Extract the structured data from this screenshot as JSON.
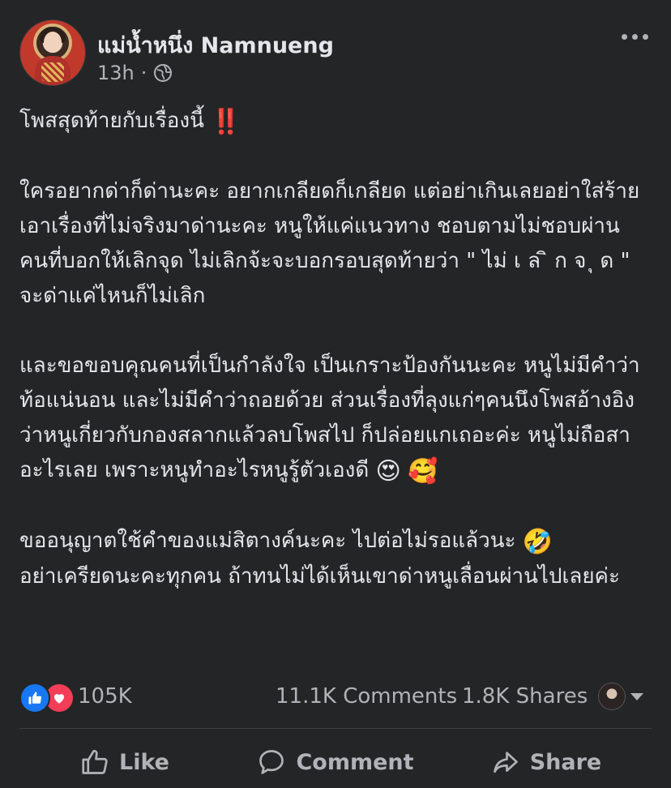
{
  "post": {
    "author": "แม่น้ำหนึ่ง Namnueng",
    "time": "13h",
    "separator": "·",
    "paragraph1_text": "โพสสุดท้ายกับเรื่องนี้ ",
    "paragraph1_emoji": "‼️",
    "paragraph2": "ใครอยากด่าก็ด่านะคะ อยากเกลียดก็เกลียด แต่อย่าเกินเลยอย่าใส่ร้ายเอาเรื่องที่ไม่จริงมาด่านะคะ หนูให้แค่แนวทาง ชอบตามไม่ชอบผ่าน คนที่บอกให้เลิกจุด ไม่เลิกจ้ะจะบอกรอบสุดท้ายว่า \" ไม่ เ ล ิ ก จ ุ ด \" จะด่าแค่ไหนก็ไม่เลิก",
    "paragraph3_text": "และขอขอบคุณคนที่เป็นกำลังใจ เป็นเกราะป้องกันนะคะ หนูไม่มีคำว่าท้อแน่นอน และไม่มีคำว่าถอยด้วย ส่วนเรื่องที่ลุงแก่ๆคนนึงโพสอ้างอิงว่าหนูเกี่ยวกับกองสลากแล้วลบโพสไป ก็ปล่อยแกเถอะค่ะ หนูไม่ถือสาอะไรเลย เพราะหนูทำอะไรหนูรู้ตัวเองดี ",
    "paragraph3_emoji1": "😍",
    "paragraph3_emoji2": "🥰",
    "paragraph4_text1": "ขออนุญาตใช้คำของแม่สิตางค์นะคะ ไปต่อไม่รอแล้วนะ ",
    "paragraph4_emoji": "🤣",
    "paragraph4_text2": "อย่าเครียดนะคะทุกคน ถ้าทนไม่ได้เห็นเขาด่าหนูเลื่อนผ่านไปเลยค่ะ"
  },
  "stats": {
    "reactions": "105K",
    "comments": "11.1K Comments",
    "shares": "1.8K Shares"
  },
  "actions": {
    "like": "Like",
    "comment": "Comment",
    "share": "Share"
  },
  "icons": [
    "globe-icon",
    "more-icon",
    "like-reaction-icon",
    "love-reaction-icon",
    "thumbs-up-icon",
    "comment-icon",
    "share-icon"
  ]
}
